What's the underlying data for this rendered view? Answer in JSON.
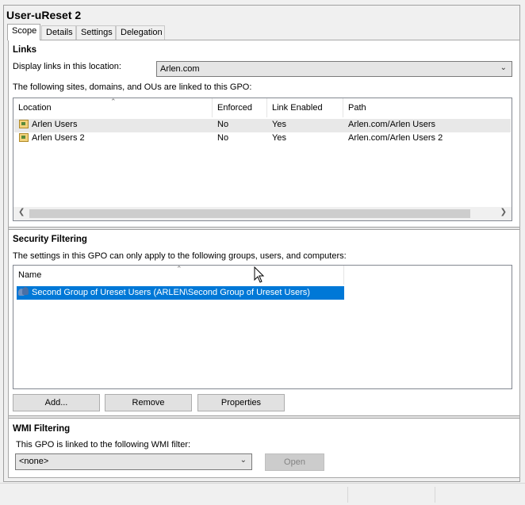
{
  "window": {
    "title": "User-uReset 2"
  },
  "tabs": [
    {
      "label": "Scope",
      "active": true
    },
    {
      "label": "Details",
      "active": false
    },
    {
      "label": "Settings",
      "active": false
    },
    {
      "label": "Delegation",
      "active": false
    }
  ],
  "links": {
    "heading": "Links",
    "location_label": "Display links in this location:",
    "location_value": "Arlen.com",
    "description": "The following sites, domains, and OUs are linked to this GPO:",
    "columns": [
      "Location",
      "Enforced",
      "Link Enabled",
      "Path"
    ],
    "rows": [
      {
        "location": "Arlen Users",
        "enforced": "No",
        "link_enabled": "Yes",
        "path": "Arlen.com/Arlen Users"
      },
      {
        "location": "Arlen Users 2",
        "enforced": "No",
        "link_enabled": "Yes",
        "path": "Arlen.com/Arlen Users 2"
      }
    ]
  },
  "security": {
    "heading": "Security Filtering",
    "description": "The settings in this GPO can only apply to the following groups, users, and computers:",
    "column": "Name",
    "rows": [
      {
        "name": "Second Group of Ureset Users (ARLEN\\Second Group of Ureset Users)",
        "selected": true
      }
    ],
    "buttons": {
      "add": "Add...",
      "remove": "Remove",
      "properties": "Properties"
    }
  },
  "wmi": {
    "heading": "WMI Filtering",
    "description": "This GPO is linked to the following WMI filter:",
    "value": "<none>",
    "open_label": "Open"
  },
  "icons": {
    "sort": "sort-up-icon",
    "dropdown": "chevron-down-icon",
    "ou": "organizational-unit-icon",
    "group": "user-group-icon",
    "cursor": "mouse-pointer-icon"
  },
  "colors": {
    "selection": "#0078d7",
    "panel": "#ffffff",
    "chrome": "#f0f0f0"
  }
}
